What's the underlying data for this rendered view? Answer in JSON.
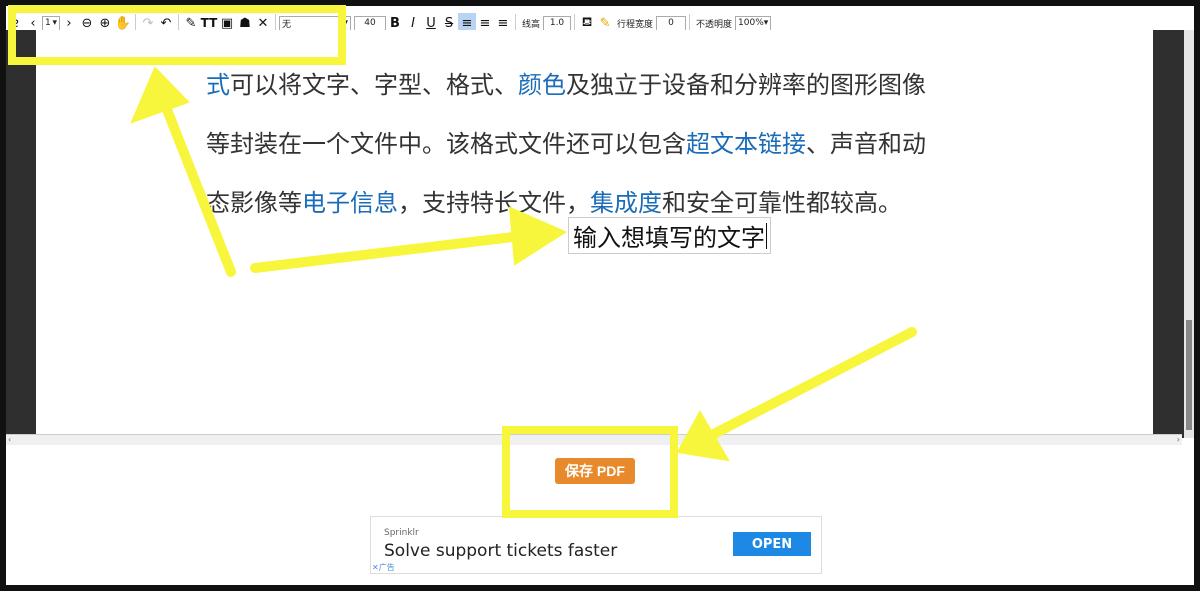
{
  "toolbar": {
    "page_select": "1",
    "font_select": "无",
    "font_size": "40",
    "bold": "B",
    "italic": "I",
    "underline": "U",
    "strike": "S",
    "line_height_label": "线高",
    "line_height_value": "1.0",
    "row_width_label": "行程宽度",
    "row_width_value": "0",
    "opacity_label": "不透明度",
    "opacity_value": "100%"
  },
  "document": {
    "line1": [
      {
        "text": "式",
        "link": true
      },
      {
        "text": "可以将文字、字型、格式、",
        "link": false
      },
      {
        "text": "颜色",
        "link": true
      },
      {
        "text": "及独立于设备和分辨率的图形图像",
        "link": false
      }
    ],
    "line2": [
      {
        "text": "等封装在一个文件中。该格式文件还可以包含",
        "link": false
      },
      {
        "text": "超文本链接",
        "link": true
      },
      {
        "text": "、声音和动",
        "link": false
      }
    ],
    "line3": [
      {
        "text": "态影像等",
        "link": false
      },
      {
        "text": "电子信息",
        "link": true
      },
      {
        "text": "，支持特长文件，",
        "link": false
      },
      {
        "text": "集成度",
        "link": true
      },
      {
        "text": "和安全可靠性都较高。",
        "link": false
      }
    ],
    "textbox_value": "输入想填写的文字"
  },
  "actions": {
    "save_pdf_label": "保存 PDF"
  },
  "ad": {
    "brand": "Sprinklr",
    "headline": "Solve support tickets faster",
    "cta": "OPEN",
    "mark": "✕广告"
  },
  "colors": {
    "highlight": "#f7f53c",
    "link": "#1b6cb8",
    "save_button": "#e88a2b",
    "ad_button": "#1e88e5"
  }
}
